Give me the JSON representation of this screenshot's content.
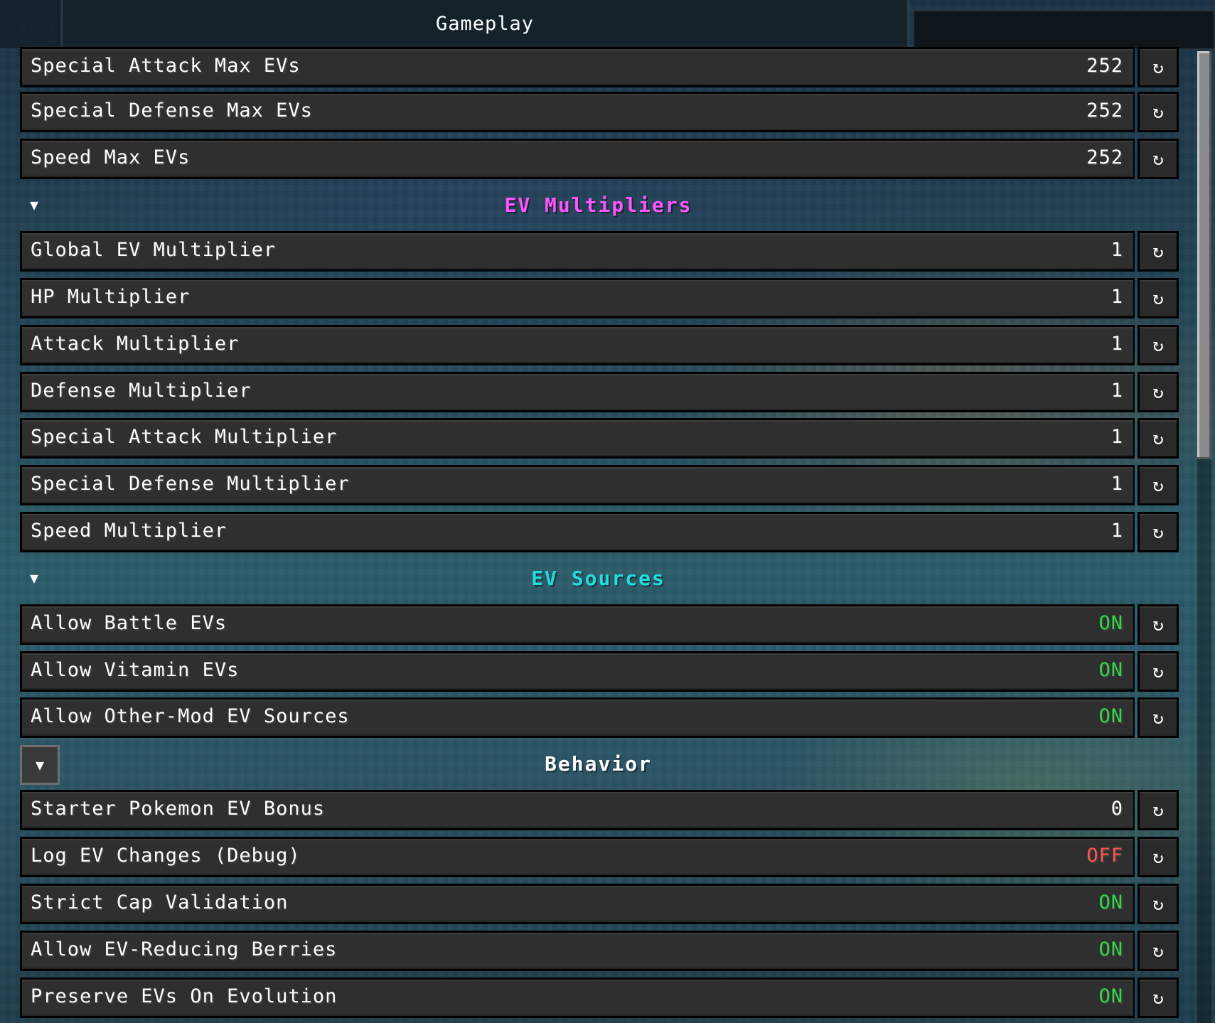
{
  "tabs": {
    "active_label": "Gameplay"
  },
  "colors": {
    "on": "#2fd84a",
    "off": "#ff5555",
    "number": "#ffffff",
    "ev_multipliers_header": "#ff55ff",
    "ev_sources_header": "#22dddd",
    "behavior_header": "#ffffff"
  },
  "icons": {
    "reset": "reset-icon",
    "collapse": "triangle-down-icon",
    "reset_glyph": "↻",
    "collapse_glyph": "▼"
  },
  "rows_top": [
    {
      "label": "Special Attack Max EVs",
      "value": "252",
      "kind": "number"
    },
    {
      "label": "Special Defense Max EVs",
      "value": "252",
      "kind": "number"
    },
    {
      "label": "Speed Max EVs",
      "value": "252",
      "kind": "number"
    }
  ],
  "sections": [
    {
      "title": "EV Multipliers",
      "color_key": "ev_multipliers_header",
      "rows": [
        {
          "label": "Global EV Multiplier",
          "value": "1",
          "kind": "number"
        },
        {
          "label": "HP Multiplier",
          "value": "1",
          "kind": "number"
        },
        {
          "label": "Attack Multiplier",
          "value": "1",
          "kind": "number"
        },
        {
          "label": "Defense Multiplier",
          "value": "1",
          "kind": "number"
        },
        {
          "label": "Special Attack Multiplier",
          "value": "1",
          "kind": "number"
        },
        {
          "label": "Special Defense Multiplier",
          "value": "1",
          "kind": "number"
        },
        {
          "label": "Speed Multiplier",
          "value": "1",
          "kind": "number"
        }
      ]
    },
    {
      "title": "EV Sources",
      "color_key": "ev_sources_header",
      "rows": [
        {
          "label": "Allow Battle EVs",
          "value": "ON",
          "kind": "on"
        },
        {
          "label": "Allow Vitamin EVs",
          "value": "ON",
          "kind": "on"
        },
        {
          "label": "Allow Other-Mod EV Sources",
          "value": "ON",
          "kind": "on"
        }
      ]
    },
    {
      "title": "Behavior",
      "color_key": "behavior_header",
      "rows": [
        {
          "label": "Starter Pokemon EV Bonus",
          "value": "0",
          "kind": "number"
        },
        {
          "label": "Log EV Changes (Debug)",
          "value": "OFF",
          "kind": "off"
        },
        {
          "label": "Strict Cap Validation",
          "value": "ON",
          "kind": "on"
        },
        {
          "label": "Allow EV-Reducing Berries",
          "value": "ON",
          "kind": "on"
        },
        {
          "label": "Preserve EVs On Evolution",
          "value": "ON",
          "kind": "on"
        }
      ]
    }
  ]
}
